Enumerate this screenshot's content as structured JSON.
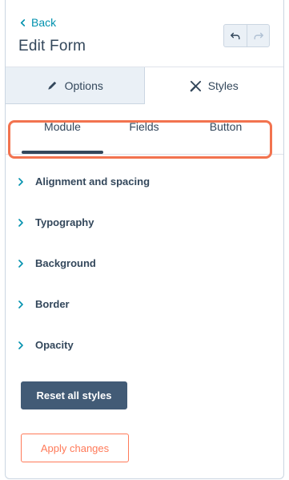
{
  "header": {
    "back_label": "Back",
    "title": "Edit Form",
    "undo_icon": "undo-icon",
    "redo_icon": "redo-icon"
  },
  "main_tabs": [
    {
      "label": "Options",
      "icon": "pencil-icon",
      "active": false
    },
    {
      "label": "Styles",
      "icon": "brush-icon",
      "active": true
    }
  ],
  "sub_tabs": [
    {
      "label": "Module",
      "active": true
    },
    {
      "label": "Fields",
      "active": false
    },
    {
      "label": "Button",
      "active": false
    }
  ],
  "accordion": [
    {
      "label": "Alignment and spacing"
    },
    {
      "label": "Typography"
    },
    {
      "label": "Background"
    },
    {
      "label": "Border"
    },
    {
      "label": "Opacity"
    }
  ],
  "actions": {
    "reset_label": "Reset all styles",
    "apply_label": "Apply changes"
  },
  "colors": {
    "link": "#0091ae",
    "text": "#33475b",
    "highlight": "#f2734f",
    "primary_button": "#425b76",
    "apply_accent": "#ff7a59"
  }
}
